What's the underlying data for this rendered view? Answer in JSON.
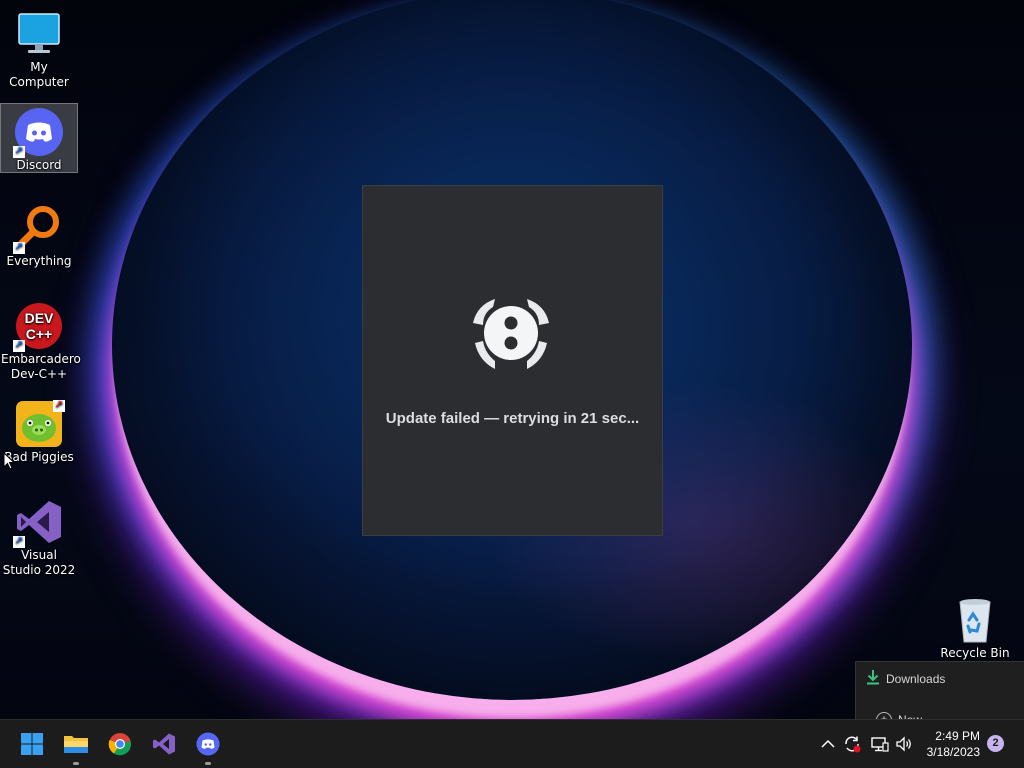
{
  "desktop": {
    "icons": [
      {
        "label": "My Computer"
      },
      {
        "label": "Discord"
      },
      {
        "label": "Everything"
      },
      {
        "label": "Embarcadero Dev-C++"
      },
      {
        "label": "Bad Piggies"
      },
      {
        "label": "Visual Studio 2022"
      }
    ],
    "recycle_bin": {
      "label": "Recycle Bin"
    }
  },
  "splash": {
    "message": "Update failed — retrying in 21 sec..."
  },
  "downloads": {
    "title": "Downloads",
    "new_label": "New"
  },
  "taskbar": {
    "apps": [
      "start-icon",
      "file-explorer-icon",
      "chrome-icon",
      "visual-studio-icon",
      "discord-icon"
    ],
    "clock": {
      "time": "2:49 PM",
      "date": "3/18/2023"
    },
    "notification_count": "2"
  },
  "colors": {
    "splash_bg": "#2b2d31",
    "discord_blurple": "#5865f2",
    "taskbar_bg": "#1c1c1c"
  }
}
